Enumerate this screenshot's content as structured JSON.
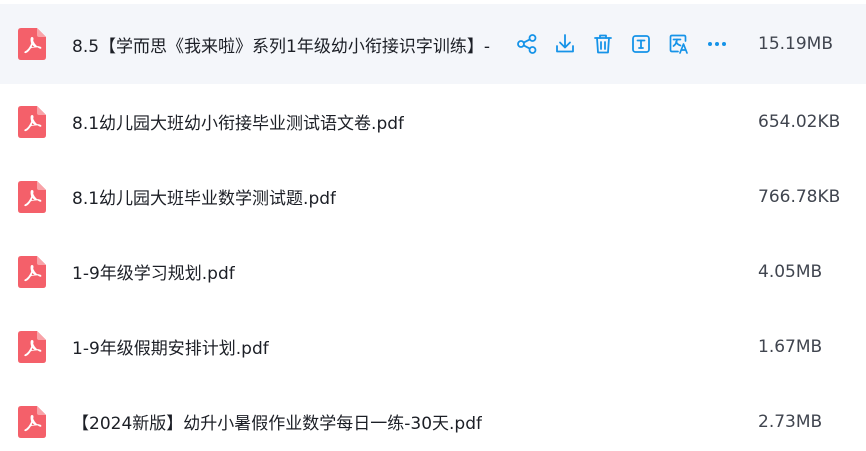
{
  "accent_color": "#1593e8",
  "icon_color": "#f4606a",
  "files": [
    {
      "name": "8.5【学而思《我来啦》系列1年级幼小衔接识字训练】-",
      "size": "15.19MB"
    },
    {
      "name": "8.1幼儿园大班幼小衔接毕业测试语文卷.pdf",
      "size": "654.02KB"
    },
    {
      "name": "8.1幼儿园大班毕业数学测试题.pdf",
      "size": "766.78KB"
    },
    {
      "name": "1-9年级学习规划.pdf",
      "size": "4.05MB"
    },
    {
      "name": "1-9年级假期安排计划.pdf",
      "size": "1.67MB"
    },
    {
      "name": "【2024新版】幼升小暑假作业数学每日一练-30天.pdf",
      "size": "2.73MB"
    }
  ],
  "row_actions": [
    "share-icon",
    "download-icon",
    "delete-icon",
    "text-extract-icon",
    "translate-icon",
    "more-icon"
  ]
}
